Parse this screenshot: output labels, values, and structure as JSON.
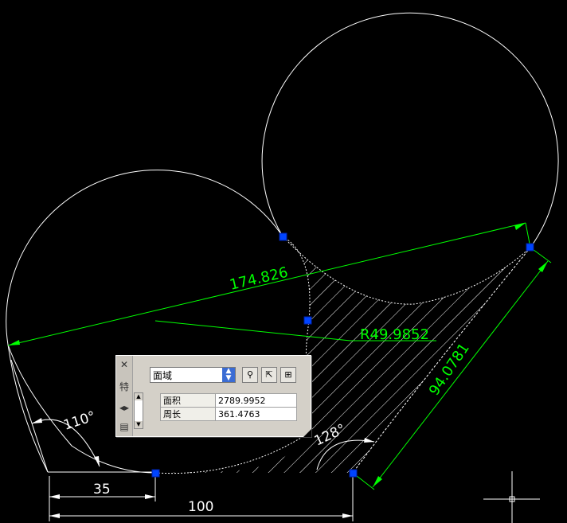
{
  "drawing": {
    "dimensions": {
      "aligned_long": "174.826",
      "radius": "R49.9852",
      "aligned_side": "94.0781",
      "angle_left": "110°",
      "angle_right": "128°",
      "linear_short": "35",
      "linear_long": "100"
    },
    "colors": {
      "background": "#000000",
      "geometry": "#ffffff",
      "dimension": "#00ff00",
      "grip": "#0044ff"
    }
  },
  "properties_palette": {
    "object_type": "面域",
    "icons": [
      "close-icon",
      "pin-icon",
      "autohide-icon",
      "properties-icon",
      "quick-select-icon",
      "select-objects-icon",
      "pickadd-icon"
    ],
    "rows": [
      {
        "label": "面积",
        "value": "2789.9952"
      },
      {
        "label": "周长",
        "value": "361.4763"
      }
    ]
  }
}
